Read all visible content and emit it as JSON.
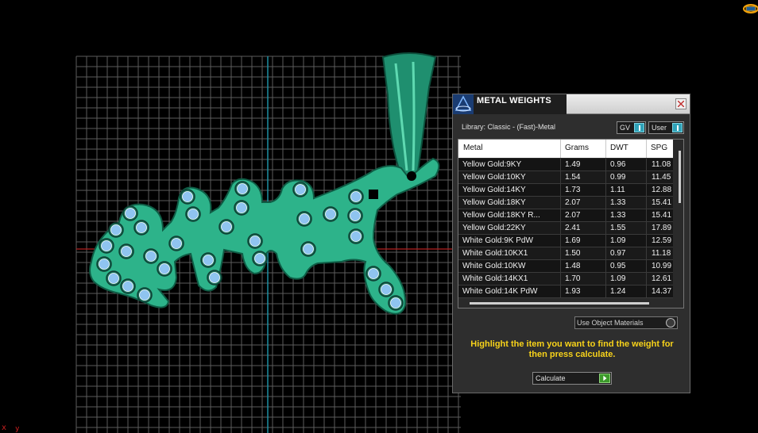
{
  "viewport": {
    "axis_x_marker": "x",
    "axis_y_marker": "y",
    "colors": {
      "background": "#000000",
      "grid": "#5c5c5c",
      "axis_vertical": "#1d8fa3",
      "axis_horizontal": "#b42020",
      "model": "#2db38a",
      "gems": "#8fc4f0"
    }
  },
  "panel": {
    "title": "METAL WEIGHTS",
    "library": "Library: Classic - (Fast)-Metal",
    "toggles": {
      "gv": "GV",
      "user": "User"
    },
    "table": {
      "headers": {
        "metal": "Metal",
        "grams": "Grams",
        "dwt": "DWT",
        "spg": "SPG"
      },
      "rows": [
        {
          "metal": "Yellow Gold:9KY",
          "grams": "1.49",
          "dwt": "0.96",
          "spg": "11.08"
        },
        {
          "metal": "Yellow Gold:10KY",
          "grams": "1.54",
          "dwt": "0.99",
          "spg": "11.45"
        },
        {
          "metal": "Yellow Gold:14KY",
          "grams": "1.73",
          "dwt": "1.11",
          "spg": "12.88"
        },
        {
          "metal": "Yellow Gold:18KY",
          "grams": "2.07",
          "dwt": "1.33",
          "spg": "15.41"
        },
        {
          "metal": "Yellow Gold:18KY R...",
          "grams": "2.07",
          "dwt": "1.33",
          "spg": "15.41"
        },
        {
          "metal": "Yellow Gold:22KY",
          "grams": "2.41",
          "dwt": "1.55",
          "spg": "17.89"
        },
        {
          "metal": "White Gold:9K PdW",
          "grams": "1.69",
          "dwt": "1.09",
          "spg": "12.59"
        },
        {
          "metal": "White Gold:10KX1",
          "grams": "1.50",
          "dwt": "0.97",
          "spg": "11.18"
        },
        {
          "metal": "White Gold:10KW",
          "grams": "1.48",
          "dwt": "0.95",
          "spg": "10.99"
        },
        {
          "metal": "White Gold:14KX1",
          "grams": "1.70",
          "dwt": "1.09",
          "spg": "12.61"
        },
        {
          "metal": "White Gold:14K PdW",
          "grams": "1.93",
          "dwt": "1.24",
          "spg": "14.37"
        }
      ]
    },
    "use_object_materials": "Use Object Materials",
    "hint": "Highlight the item you want to find the weight for then press calculate.",
    "calculate": "Calculate",
    "colors": {
      "panel_bg": "#2e2e2e",
      "hint": "#f7d21a",
      "toggle_on": "#2fa2b8",
      "go": "#3c9a2b"
    }
  }
}
